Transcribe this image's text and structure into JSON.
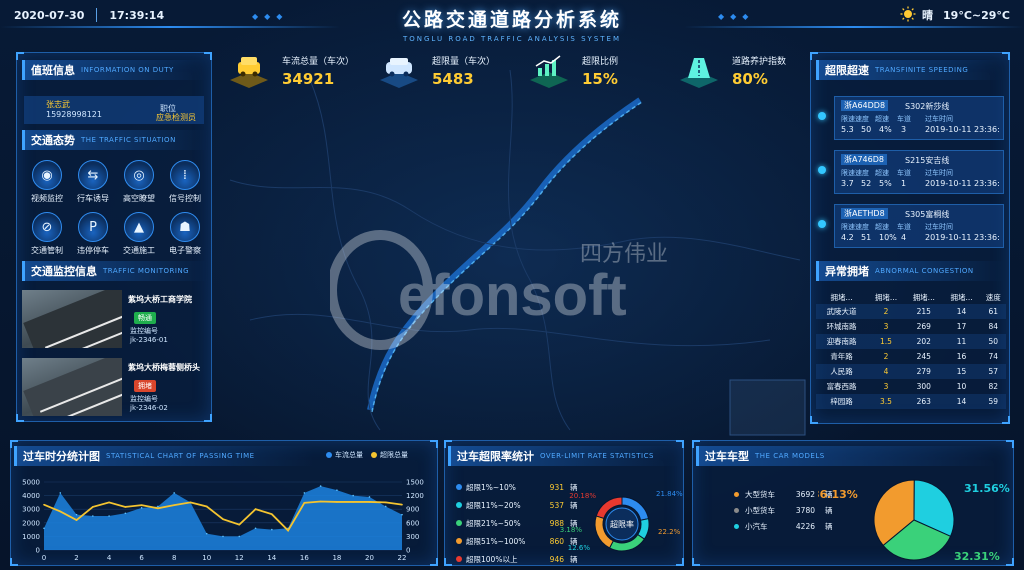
{
  "header": {
    "date": "2020-07-30",
    "time": "17:39:14",
    "title": "公路交通道路分析系统",
    "subtitle": "TONGLU ROAD TRAFFIC ANALYSIS SYSTEM",
    "weather": "晴",
    "temperature": "19°C~29°C",
    "weather_icon": "sun-icon"
  },
  "watermark": {
    "brand": "efonsoft",
    "cn": "四方伟业"
  },
  "duty": {
    "title": "值班信息",
    "title_en": "INFORMATION ON DUTY",
    "name": "张志武",
    "phone": "15928998121",
    "position_label": "职位",
    "position_value": "应急检测员"
  },
  "situation": {
    "title": "交通态势",
    "title_en": "THE TRAFFIC SITUATION",
    "items": [
      {
        "label": "视频监控",
        "icon": "camera-icon"
      },
      {
        "label": "行车诱导",
        "icon": "guide-icon"
      },
      {
        "label": "高空瞭望",
        "icon": "watch-icon"
      },
      {
        "label": "信号控制",
        "icon": "traffic-light-icon"
      },
      {
        "label": "交通管制",
        "icon": "no-entry-icon"
      },
      {
        "label": "违停停车",
        "icon": "parking-icon"
      },
      {
        "label": "交通施工",
        "icon": "construction-icon"
      },
      {
        "label": "电子警察",
        "icon": "police-icon"
      }
    ]
  },
  "monitoring": {
    "title": "交通监控信息",
    "title_en": "TRAFFIC MONITORING",
    "cameras": [
      {
        "place": "紫坞大桥工商学院",
        "status": "畅通",
        "status_color": "#1fae4d",
        "label": "监控编号",
        "code": "jk-2346-01"
      },
      {
        "place": "紫坞大桥梅蓉侧桥头",
        "status": "拥堵",
        "status_color": "#d9462c",
        "label": "监控编号",
        "code": "jk-2346-02"
      }
    ]
  },
  "kpis": [
    {
      "label": "车流总量（车次）",
      "value": "34921",
      "icon": "car-icon"
    },
    {
      "label": "超限量（车次）",
      "value": "5483",
      "icon": "vehicle-icon"
    },
    {
      "label": "超限比例",
      "value": "15%",
      "icon": "trend-icon"
    },
    {
      "label": "道路养护指数",
      "value": "80%",
      "icon": "road-icon"
    }
  ],
  "overspeed": {
    "title": "超限超速",
    "title_en": "TRANSFINITE SPEEDING",
    "headers": [
      "限速速度",
      "超速",
      "车道",
      "过车时间"
    ],
    "items": [
      {
        "plate": "浙A64DD8",
        "road": "S302新莎线",
        "limit": "5.3",
        "speed": "50",
        "pct": "4%",
        "lane": "3",
        "time": "2019-10-11 23:36:"
      },
      {
        "plate": "浙A746D8",
        "road": "S215安吉线",
        "limit": "3.7",
        "speed": "52",
        "pct": "5%",
        "lane": "1",
        "time": "2019-10-11 23:36:"
      },
      {
        "plate": "浙AETHD8",
        "road": "S305富桐线",
        "limit": "4.2",
        "speed": "51",
        "pct": "10%",
        "lane": "4",
        "time": "2019-10-11 23:36:"
      }
    ]
  },
  "congestion": {
    "title": "异常拥堵",
    "title_en": "ABNORMAL CONGESTION",
    "columns": [
      "拥堵...",
      "拥堵...",
      "拥堵...",
      "拥堵...",
      "速度"
    ],
    "rows": [
      [
        "武陵大道",
        "2",
        "215",
        "14",
        "61"
      ],
      [
        "环城南路",
        "3",
        "269",
        "17",
        "84"
      ],
      [
        "迎春南路",
        "1.5",
        "202",
        "11",
        "50"
      ],
      [
        "青年路",
        "2",
        "245",
        "16",
        "74"
      ],
      [
        "人民路",
        "4",
        "279",
        "15",
        "57"
      ],
      [
        "富春西路",
        "3",
        "300",
        "10",
        "82"
      ],
      [
        "梓园路",
        "3.5",
        "263",
        "14",
        "59"
      ]
    ]
  },
  "passing_chart_panel": {
    "title": "过车时分统计图",
    "title_en": "STATISTICAL CHART OF PASSING TIME",
    "legend": [
      {
        "name": "车流总量",
        "color": "#2d8cf0"
      },
      {
        "name": "超限总量",
        "color": "#f4c430"
      }
    ]
  },
  "overlimit_panel": {
    "title": "过车超限率统计",
    "title_en": "OVER-LIMIT RATE STATISTICS",
    "rows": [
      {
        "name": "超限1%~10%",
        "count": "931",
        "unit": "辆",
        "color": "#2d8cf0"
      },
      {
        "name": "超限11%~20%",
        "count": "537",
        "unit": "辆",
        "color": "#1fcfe0"
      },
      {
        "name": "超限21%~50%",
        "count": "988",
        "unit": "辆",
        "color": "#3ad17a"
      },
      {
        "name": "超限51%~100%",
        "count": "860",
        "unit": "辆",
        "color": "#f29b2e"
      },
      {
        "name": "超限100%以上",
        "count": "946",
        "unit": "辆",
        "color": "#e8392f"
      }
    ],
    "donut_center": "超限率"
  },
  "models_panel": {
    "title": "过车车型",
    "title_en": "THE CAR MODELS",
    "rows": [
      {
        "name": "大型货车",
        "count": "3692",
        "unit": "辆",
        "color": "#f29b2e"
      },
      {
        "name": "小型货车",
        "count": "3780",
        "unit": "辆",
        "color": "#8b8b8b"
      },
      {
        "name": "小汽车",
        "count": "4226",
        "unit": "辆",
        "color": "#1fcfe0"
      }
    ]
  },
  "chart_data": [
    {
      "type": "area",
      "title": "过车时分统计图",
      "x": [
        0,
        1,
        2,
        3,
        4,
        5,
        6,
        7,
        8,
        9,
        10,
        11,
        12,
        13,
        14,
        15,
        16,
        17,
        18,
        19,
        20,
        21,
        22
      ],
      "x_ticks": [
        0,
        2,
        4,
        6,
        8,
        10,
        12,
        14,
        16,
        18,
        20,
        22
      ],
      "ylim_left": [
        0,
        5000
      ],
      "y_ticks_left": [
        0,
        1000,
        2000,
        3000,
        4000,
        5000
      ],
      "ylim_right": [
        0,
        1500
      ],
      "y_ticks_right": [
        0,
        300,
        600,
        900,
        1200,
        1500
      ],
      "series": [
        {
          "name": "车流总量",
          "axis": "left",
          "values": [
            1600,
            4200,
            2600,
            2500,
            2500,
            2700,
            3100,
            3200,
            4200,
            3500,
            1200,
            1000,
            1000,
            1600,
            1500,
            1600,
            4200,
            4700,
            4400,
            4000,
            3900,
            3200,
            2600
          ]
        },
        {
          "name": "超限总量",
          "axis": "right",
          "values": [
            1000,
            850,
            660,
            950,
            1050,
            950,
            990,
            920,
            990,
            1050,
            960,
            680,
            560,
            900,
            790,
            430,
            1040,
            1070,
            1060,
            1060,
            1060,
            1050,
            1000
          ]
        }
      ],
      "grid": true,
      "legend": "top-right"
    },
    {
      "type": "pie",
      "title": "超限率",
      "labels": [
        "超限1%~10%",
        "超限11%~20%",
        "超限21%~50%",
        "超限51%~100%",
        "超限100%以上"
      ],
      "values": [
        21.84,
        12.6,
        23.18,
        22.2,
        20.18
      ],
      "value_labels": [
        "21.84%",
        "12.6%",
        "23.18%",
        "22.2%",
        "20.18%"
      ],
      "colors": [
        "#2d8cf0",
        "#1fcfe0",
        "#3ad17a",
        "#f29b2e",
        "#e8392f"
      ]
    },
    {
      "type": "pie",
      "title": "过车车型",
      "labels": [
        "大型货车",
        "小汽车",
        "小型货车"
      ],
      "values": [
        36.13,
        31.56,
        32.31
      ],
      "value_labels": [
        "36.13%",
        "31.56%",
        "32.31%"
      ],
      "colors": [
        "#f29b2e",
        "#1fcfe0",
        "#3ad17a"
      ]
    }
  ]
}
